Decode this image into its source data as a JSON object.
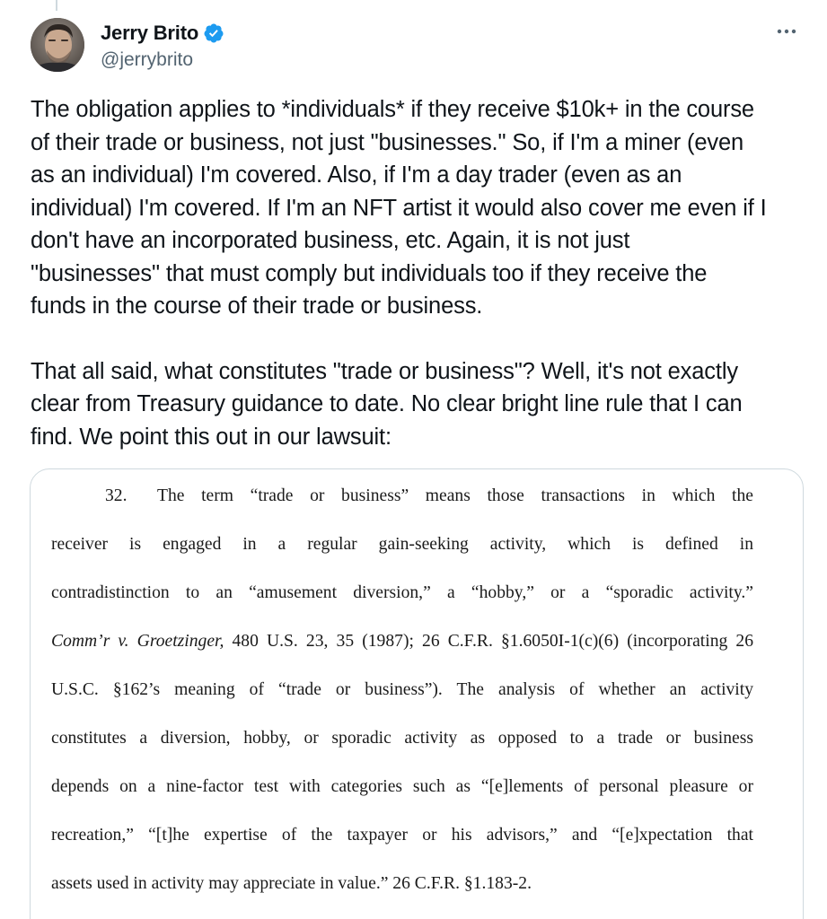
{
  "author": {
    "display_name": "Jerry Brito",
    "handle": "@jerrybrito",
    "verified": true,
    "verified_color": "#1d9bf0"
  },
  "more_icon": "more-horizontal-icon",
  "tweet": {
    "paragraph_1": "The obligation applies to *individuals* if they receive $10k+ in the course\nof their trade or business, not just \"businesses.\" So, if I'm a miner (even\nas an individual) I'm covered. Also, if I'm a day trader (even as an\nindividual) I'm covered. If I'm an NFT artist it would also cover me even if I\ndon't have an incorporated business, etc. Again, it is not just\n\"businesses\" that must comply but individuals too if they receive the\nfunds in the course of their trade or business.",
    "paragraph_2": "That all said, what constitutes \"trade or business\"? Well, it's not exactly\nclear from Treasury guidance to date. No clear bright line rule that I can\nfind. We point this out in our lawsuit:"
  },
  "document": {
    "paragraph_number": "32.",
    "line_1": "The term “trade or business” means those transactions in which the",
    "line_2": "receiver is engaged in a regular gain-seeking activity, which is defined in",
    "line_3": "contradistinction to an “amusement diversion,” a “hobby,” or a “sporadic activity.”",
    "line_4_case": "Comm’r v. Groetzinger,",
    "line_4_rest": " 480 U.S. 23, 35 (1987); 26 C.F.R. §1.6050I-1(c)(6) (incorporating 26",
    "line_5": "U.S.C. §162’s meaning of “trade or business”). The analysis of whether an activity",
    "line_6": "constitutes a diversion, hobby, or sporadic activity as opposed to a trade or business",
    "line_7": "depends on a nine-factor test with categories such as “[e]lements of personal pleasure or",
    "line_8": "recreation,” “[t]he expertise of the taxpayer or his advisors,” and “[e]xpectation that",
    "line_9": "assets used in activity may appreciate in value.” 26 C.F.R. §1.183-2."
  }
}
